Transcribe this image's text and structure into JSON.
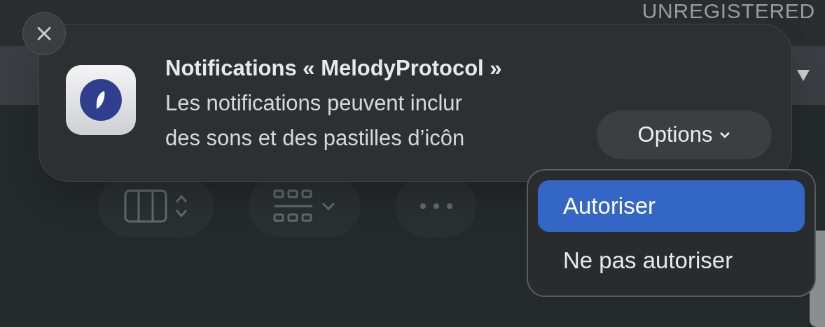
{
  "background": {
    "label": "UNREGISTERED"
  },
  "notification": {
    "title": "Notifications « MelodyProtocol »",
    "body_lines": [
      "Les notifications peuvent inclur",
      "des sons et des pastilles d’icôn"
    ],
    "options_button": "Options"
  },
  "menu": {
    "items": [
      {
        "label": "Autoriser",
        "selected": true
      },
      {
        "label": "Ne pas autoriser",
        "selected": false
      }
    ]
  }
}
